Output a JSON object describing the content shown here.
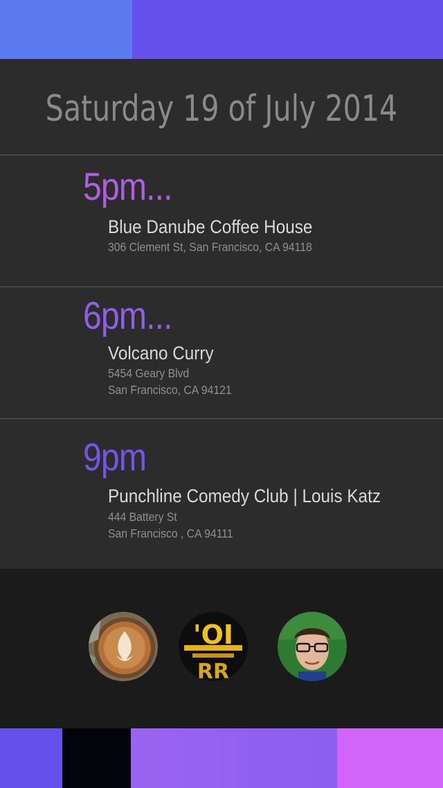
{
  "header": {
    "date": "Saturday 19 of July 2014"
  },
  "events": [
    {
      "time": "5pm...",
      "venue": "Blue Danube Coffee House",
      "address_line1": "306 Clement St, San Francisco, CA 94118",
      "address_line2": ""
    },
    {
      "time": "6pm...",
      "venue": "Volcano Curry",
      "address_line1": "5454 Geary Blvd",
      "address_line2": "San Francisco, CA 94121"
    },
    {
      "time": "9pm",
      "venue": "Punchline Comedy Club | Louis Katz",
      "address_line1": "444 Battery St",
      "address_line2": "San Francisco , CA 94111"
    }
  ],
  "avatars": [
    {
      "icon": "latte-art-photo"
    },
    {
      "icon": "volcano-curry-logo-photo"
    },
    {
      "icon": "comedian-portrait-photo"
    }
  ],
  "colors": {
    "top_bar": [
      "#5b7bef",
      "#6650ec"
    ],
    "bottom_bar": [
      "#6650ec",
      "#02030b",
      "#9b64f2",
      "#d165fa"
    ],
    "time_colors": [
      "#b05fe0",
      "#8f5fe6",
      "#7355e8"
    ]
  }
}
